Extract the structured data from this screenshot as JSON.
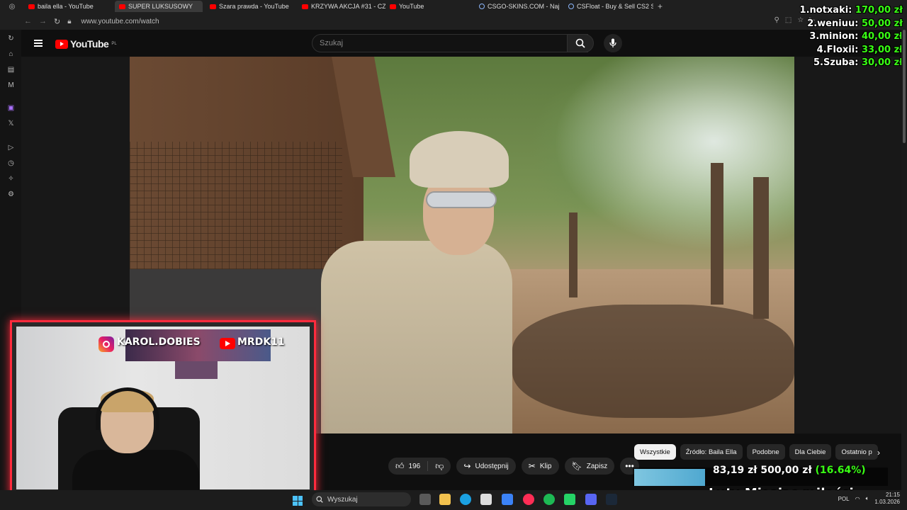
{
  "browser": {
    "tabs": [
      {
        "title": "baila ella - YouTube",
        "favicon": "youtube-icon"
      },
      {
        "title": "SUPER LUKSUSOWY",
        "favicon": "youtube-icon",
        "active": true
      },
      {
        "title": "Szara prawda - YouTube",
        "favicon": "youtube-icon"
      },
      {
        "title": "KRZYWA AKCJA #31 - CZ",
        "favicon": "youtube-icon"
      },
      {
        "title": "YouTube",
        "favicon": "youtube-icon"
      },
      {
        "title": "CSGO-SKINS.COM - Naj",
        "favicon": "globe-icon"
      },
      {
        "title": "CSFloat - Buy & Sell CS2 S",
        "favicon": "globe-icon"
      }
    ],
    "url": "www.youtube.com/watch"
  },
  "youtube": {
    "logo_text": "YouTube",
    "region": "PL",
    "search_placeholder": "Szukaj"
  },
  "actions": {
    "likes": "196",
    "share_label": "Udostępnij",
    "clip_label": "Klip",
    "save_label": "Zapisz"
  },
  "chips": [
    "Wszystkie",
    "Źródło: Baila Ella",
    "Podobne",
    "Dla Ciebie",
    "Ostatnio p"
  ],
  "webcam": {
    "instagram_handle": "KAROL.DOBIES",
    "youtube_handle": "MRDK11"
  },
  "leaderboard": [
    {
      "label": "1.notxaki:",
      "amount": "170,00 zł"
    },
    {
      "label": "2.weniuu:",
      "amount": "50,00 zł"
    },
    {
      "label": "3.minion:",
      "amount": "40,00 zł"
    },
    {
      "label": "4.Floxii:",
      "amount": "33,00 zł"
    },
    {
      "label": "5.Szuba:",
      "amount": "30,00 zł"
    }
  ],
  "goal": {
    "current": "83,19 zł",
    "target": "500,00 zł",
    "percent_text": "(16.64%)",
    "title": "Luty Miesiąc miłości"
  },
  "taskbar": {
    "search_label": "Wyszukaj",
    "time": "21:15",
    "date": "1.03.2026",
    "lang": "POL"
  },
  "colors": {
    "youtube_red": "#ff0000",
    "overlay_green": "#39ff14",
    "webcam_border": "#ff2b3d"
  }
}
